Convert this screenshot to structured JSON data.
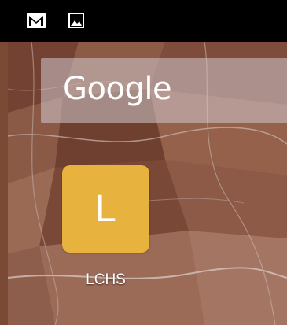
{
  "status_bar": {
    "icons": [
      "gmail-icon",
      "image-icon"
    ]
  },
  "search_widget": {
    "logo_text": "Google"
  },
  "home_apps": [
    {
      "icon_letter": "L",
      "label": "LCHS",
      "color": "#e8b23f"
    }
  ],
  "colors": {
    "status_bar": "#000000",
    "app_icon": "#e8b23f"
  }
}
